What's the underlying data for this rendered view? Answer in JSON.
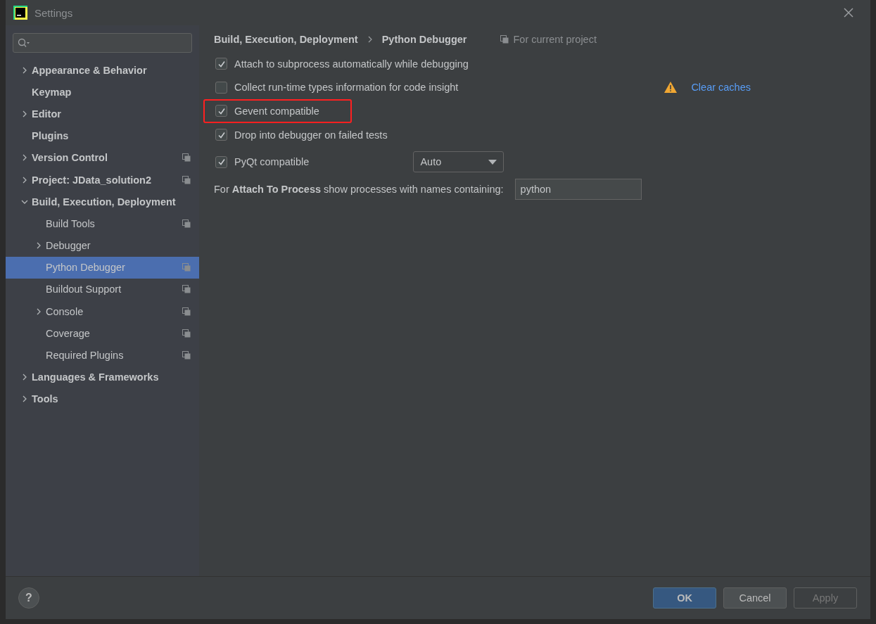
{
  "window": {
    "title": "Settings"
  },
  "help_button": "?",
  "tree": [
    {
      "label": "Appearance & Behavior",
      "expanded": false,
      "selected": false
    },
    {
      "label": "Keymap",
      "selected": false
    },
    {
      "label": "Editor",
      "expanded": false,
      "selected": false
    },
    {
      "label": "Plugins",
      "selected": false
    },
    {
      "label": "Version Control",
      "expanded": false,
      "selected": false,
      "project_scoped": true
    },
    {
      "label": "Project: JData_solution2",
      "expanded": false,
      "selected": false,
      "project_scoped": true
    },
    {
      "label": "Build, Execution, Deployment",
      "expanded": true,
      "selected": false,
      "children": [
        {
          "label": "Build Tools",
          "selected": false,
          "project_scoped": true
        },
        {
          "label": "Debugger",
          "expanded": false,
          "selected": false
        },
        {
          "label": "Python Debugger",
          "selected": true,
          "project_scoped": true
        },
        {
          "label": "Buildout Support",
          "selected": false,
          "project_scoped": true
        },
        {
          "label": "Console",
          "expanded": false,
          "selected": false,
          "project_scoped": true
        },
        {
          "label": "Coverage",
          "selected": false,
          "project_scoped": true
        },
        {
          "label": "Required Plugins",
          "selected": false,
          "project_scoped": true
        }
      ]
    },
    {
      "label": "Languages & Frameworks",
      "expanded": false,
      "selected": false
    },
    {
      "label": "Tools",
      "expanded": false,
      "selected": false
    }
  ],
  "breadcrumb": [
    "Build, Execution, Deployment",
    "Python Debugger"
  ],
  "scope_note": "For current project",
  "options": [
    {
      "kind": "checkbox",
      "label": "Attach to subprocess automatically while debugging",
      "checked": true,
      "highlighted": false
    },
    {
      "kind": "checkbox",
      "label": "Collect run-time types information for code insight",
      "checked": false,
      "highlighted": false,
      "link": "Clear caches"
    },
    {
      "kind": "checkbox",
      "label": "Gevent compatible",
      "checked": true,
      "highlighted": true
    },
    {
      "kind": "checkbox",
      "label": "Drop into debugger on failed tests",
      "checked": true,
      "highlighted": false
    },
    {
      "kind": "checkbox_dropdown",
      "label": "PyQt compatible",
      "checked": true,
      "highlighted": false,
      "value": "Auto"
    }
  ],
  "process_filter": {
    "label": "For **Attach To Process** show processes with names containing:",
    "value": "python"
  },
  "buttons": [
    {
      "label": "OK",
      "kind": "primary",
      "disabled": false
    },
    {
      "label": "Cancel",
      "kind": "normal",
      "disabled": false
    },
    {
      "label": "Apply",
      "kind": "normal",
      "disabled": true
    }
  ]
}
